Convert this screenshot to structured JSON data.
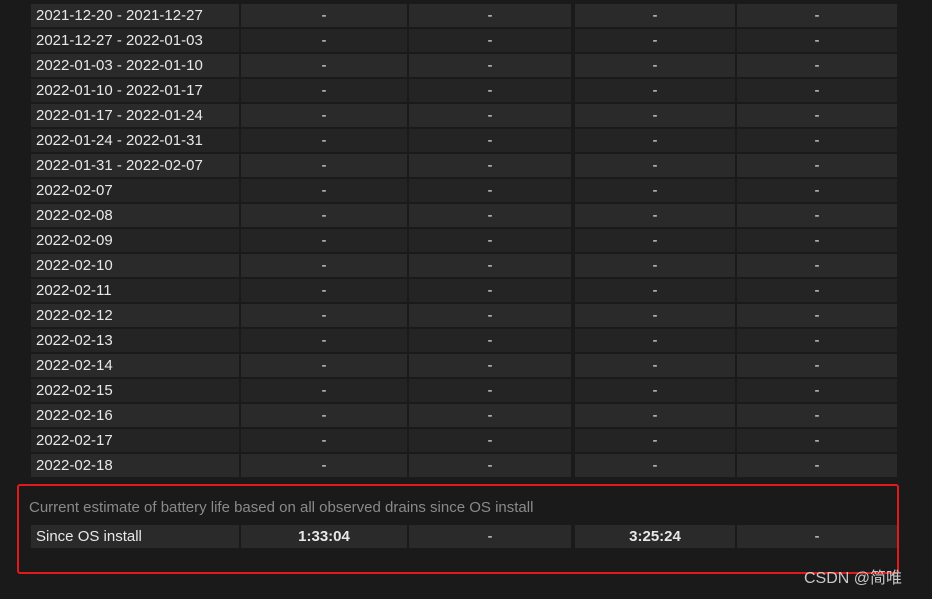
{
  "history": {
    "rows": [
      {
        "period": "2021-12-20 - 2021-12-27",
        "v1": "-",
        "v2": "-",
        "v3": "-",
        "v4": "-"
      },
      {
        "period": "2021-12-27 - 2022-01-03",
        "v1": "-",
        "v2": "-",
        "v3": "-",
        "v4": "-"
      },
      {
        "period": "2022-01-03 - 2022-01-10",
        "v1": "-",
        "v2": "-",
        "v3": "-",
        "v4": "-"
      },
      {
        "period": "2022-01-10 - 2022-01-17",
        "v1": "-",
        "v2": "-",
        "v3": "-",
        "v4": "-"
      },
      {
        "period": "2022-01-17 - 2022-01-24",
        "v1": "-",
        "v2": "-",
        "v3": "-",
        "v4": "-"
      },
      {
        "period": "2022-01-24 - 2022-01-31",
        "v1": "-",
        "v2": "-",
        "v3": "-",
        "v4": "-"
      },
      {
        "period": "2022-01-31 - 2022-02-07",
        "v1": "-",
        "v2": "-",
        "v3": "-",
        "v4": "-"
      },
      {
        "period": "2022-02-07",
        "v1": "-",
        "v2": "-",
        "v3": "-",
        "v4": "-"
      },
      {
        "period": "2022-02-08",
        "v1": "-",
        "v2": "-",
        "v3": "-",
        "v4": "-"
      },
      {
        "period": "2022-02-09",
        "v1": "-",
        "v2": "-",
        "v3": "-",
        "v4": "-"
      },
      {
        "period": "2022-02-10",
        "v1": "-",
        "v2": "-",
        "v3": "-",
        "v4": "-"
      },
      {
        "period": "2022-02-11",
        "v1": "-",
        "v2": "-",
        "v3": "-",
        "v4": "-"
      },
      {
        "period": "2022-02-12",
        "v1": "-",
        "v2": "-",
        "v3": "-",
        "v4": "-"
      },
      {
        "period": "2022-02-13",
        "v1": "-",
        "v2": "-",
        "v3": "-",
        "v4": "-"
      },
      {
        "period": "2022-02-14",
        "v1": "-",
        "v2": "-",
        "v3": "-",
        "v4": "-"
      },
      {
        "period": "2022-02-15",
        "v1": "-",
        "v2": "-",
        "v3": "-",
        "v4": "-"
      },
      {
        "period": "2022-02-16",
        "v1": "-",
        "v2": "-",
        "v3": "-",
        "v4": "-"
      },
      {
        "period": "2022-02-17",
        "v1": "-",
        "v2": "-",
        "v3": "-",
        "v4": "-"
      },
      {
        "period": "2022-02-18",
        "v1": "-",
        "v2": "-",
        "v3": "-",
        "v4": "-"
      }
    ]
  },
  "estimate": {
    "caption": "Current estimate of battery life based on all observed drains since OS install",
    "row": {
      "period": "Since OS install",
      "v1": "1:33:04",
      "v2": "-",
      "v3": "3:25:24",
      "v4": "-"
    },
    "highlight_color": "#e01a1a"
  },
  "watermark": "CSDN @简唯"
}
